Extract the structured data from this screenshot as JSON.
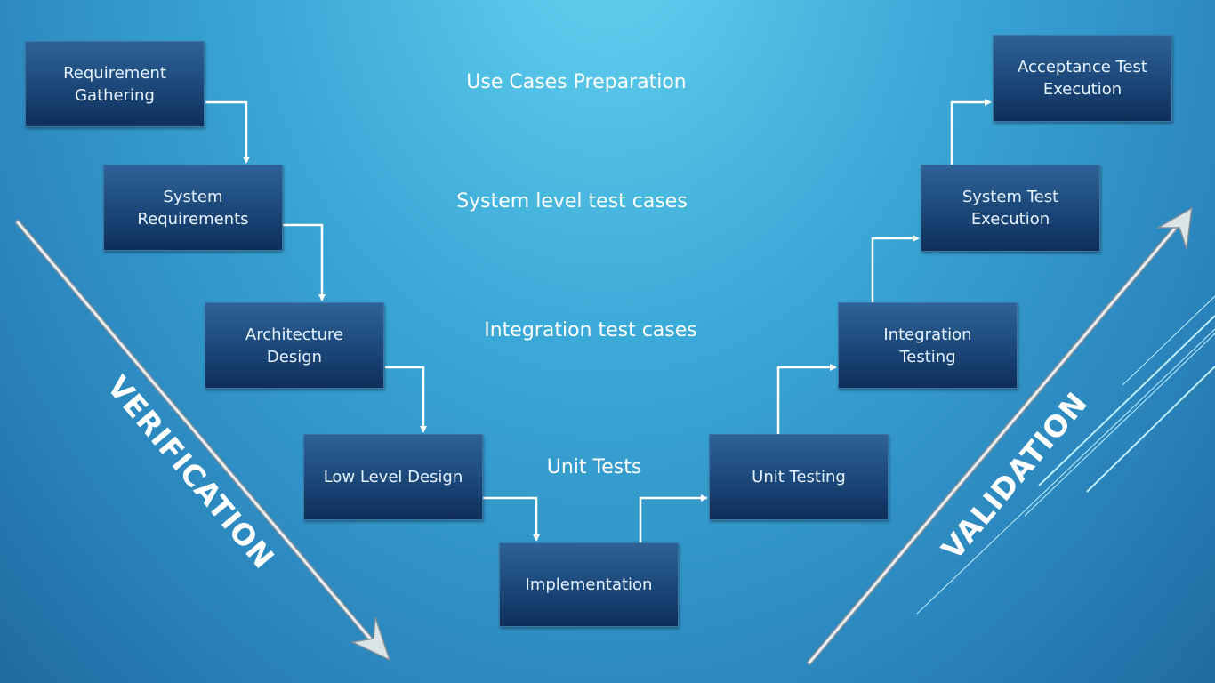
{
  "boxes": [
    {
      "label": "Requirement\nGathering"
    },
    {
      "label": "System\nRequirements"
    },
    {
      "label": "Architecture\nDesign"
    },
    {
      "label": "Low Level Design"
    },
    {
      "label": "Implementation"
    },
    {
      "label": "Unit Testing"
    },
    {
      "label": "Integration\nTesting"
    },
    {
      "label": "System Test\nExecution"
    },
    {
      "label": "Acceptance Test\nExecution"
    }
  ],
  "levels": [
    {
      "label": "Use Cases Preparation"
    },
    {
      "label": "System level test cases"
    },
    {
      "label": "Integration test cases"
    },
    {
      "label": "Unit Tests"
    }
  ],
  "sides": {
    "left": "VERIFICATION",
    "right": "VALIDATION"
  },
  "colors": {
    "box": "#1b4778",
    "connector": "#ffffff",
    "background_top": "#63d3f0",
    "background_bottom": "#1f6aa0"
  }
}
